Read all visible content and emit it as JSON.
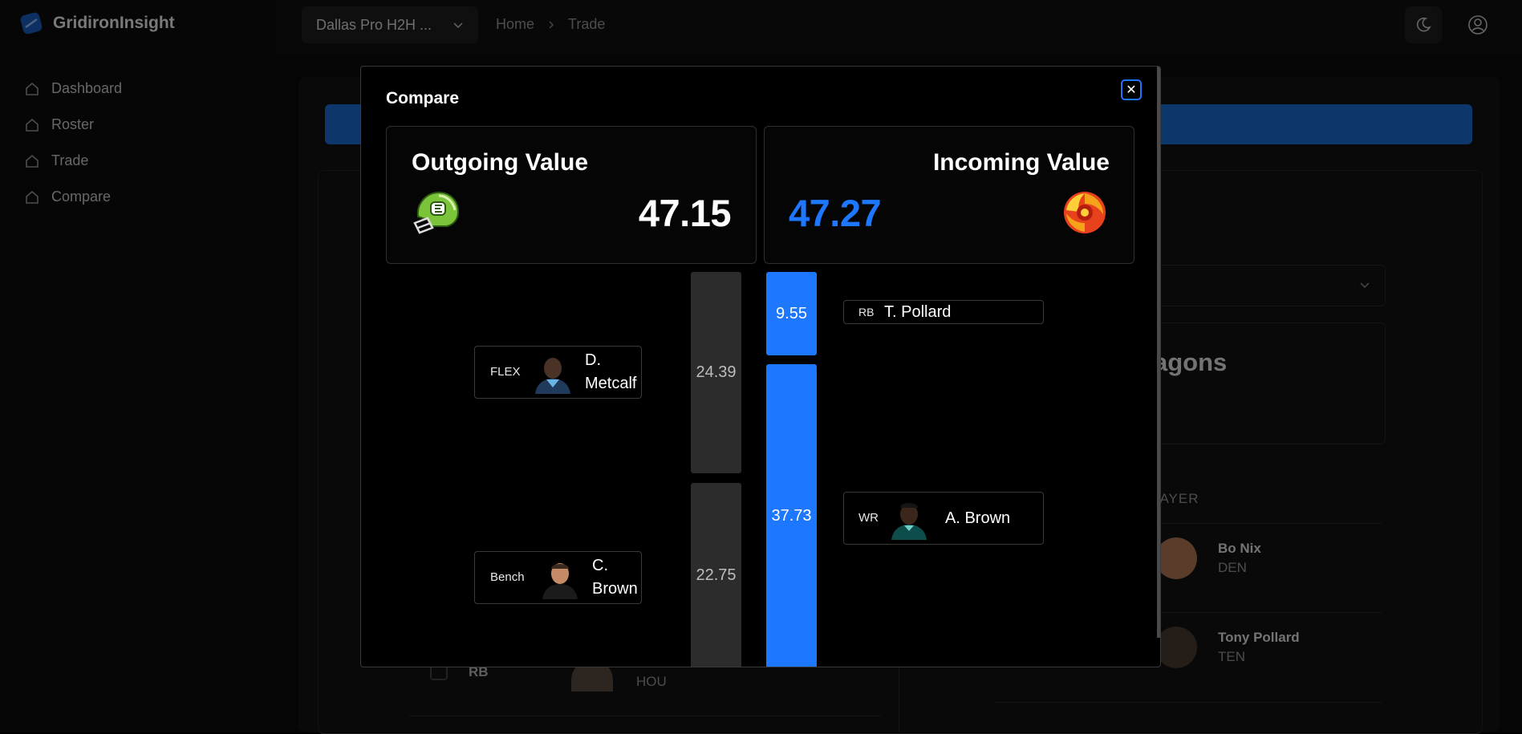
{
  "app": {
    "brand": "GridironInsight",
    "nav": [
      "Dashboard",
      "Roster",
      "Trade",
      "Compare"
    ],
    "league_select": "Dallas Pro H2H ...",
    "breadcrumb": [
      "Home",
      "Trade"
    ]
  },
  "background": {
    "team_name_partial": "agons",
    "col_header_partial": "LAYER",
    "players": [
      {
        "name": "Bo Nix",
        "team": "DEN"
      },
      {
        "name": "Tony Pollard",
        "team": "TEN"
      }
    ],
    "left_row": {
      "pos": "RB",
      "team": "HOU"
    }
  },
  "modal": {
    "title": "Compare",
    "close_icon": "close-icon",
    "outgoing": {
      "label": "Outgoing Value",
      "value": "47.15"
    },
    "incoming": {
      "label": "Incoming Value",
      "value": "47.27"
    },
    "outgoing_players": [
      {
        "slot": "FLEX",
        "name": "D. Metcalf",
        "value": "24.39"
      },
      {
        "slot": "Bench",
        "name": "C. Brown",
        "value": "22.75"
      }
    ],
    "incoming_players": [
      {
        "slot": "RB",
        "name": "T. Pollard",
        "value": "9.55"
      },
      {
        "slot": "WR",
        "name": "A. Brown",
        "value": "37.73"
      }
    ]
  },
  "colors": {
    "accent": "#1d77ff",
    "outgoing_bar": "#2c2c2c",
    "background": "#000000"
  }
}
